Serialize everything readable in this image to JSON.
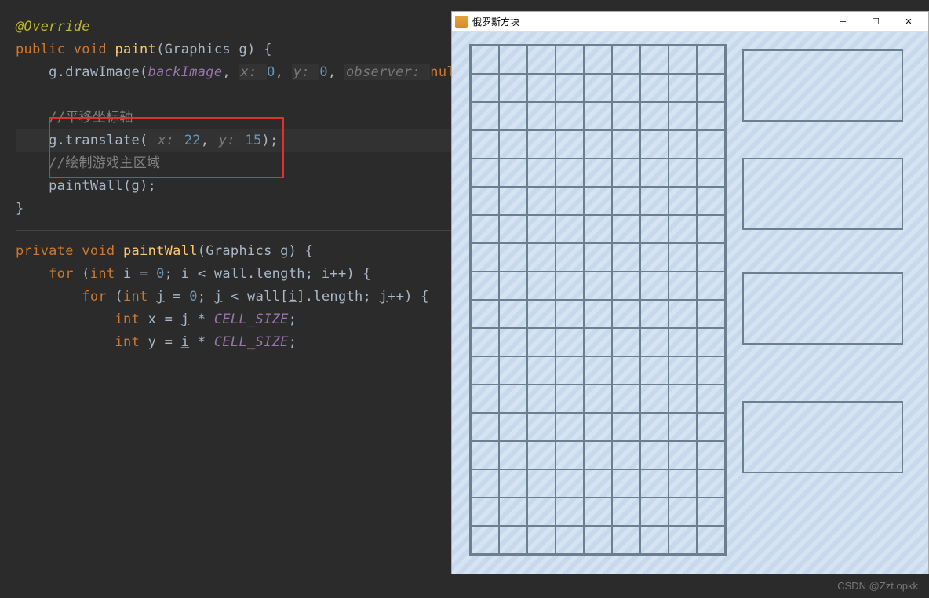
{
  "editor": {
    "lines": [
      {
        "indent": 0,
        "segs": [
          {
            "t": "@Override",
            "c": "annotation"
          }
        ]
      },
      {
        "indent": 0,
        "segs": [
          {
            "t": "public ",
            "c": "kw"
          },
          {
            "t": "void ",
            "c": "kw"
          },
          {
            "t": "paint",
            "c": "method"
          },
          {
            "t": "(Graphics g) {",
            "c": "paren"
          }
        ]
      },
      {
        "indent": 1,
        "segs": [
          {
            "t": "g.drawImage(",
            "c": "paren"
          },
          {
            "t": "backImage",
            "c": "italic"
          },
          {
            "t": ", ",
            "c": "paren"
          },
          {
            "t": "x: ",
            "c": "paramlabel"
          },
          {
            "t": "0",
            "c": "num"
          },
          {
            "t": ", ",
            "c": "paren"
          },
          {
            "t": "y: ",
            "c": "paramlabel"
          },
          {
            "t": "0",
            "c": "num"
          },
          {
            "t": ", ",
            "c": "paren"
          },
          {
            "t": "observer: ",
            "c": "paramlabel"
          },
          {
            "t": "null",
            "c": "kw"
          },
          {
            "t": ");",
            "c": "paren"
          }
        ]
      },
      {
        "indent": 1,
        "segs": [
          {
            "t": "",
            "c": ""
          }
        ]
      },
      {
        "indent": 1,
        "segs": [
          {
            "t": "//平移坐标轴",
            "c": "comment"
          }
        ]
      },
      {
        "indent": 1,
        "hl": true,
        "segs": [
          {
            "t": "g.translate(",
            "c": "paren"
          },
          {
            "t": " x: ",
            "c": "paramlabel"
          },
          {
            "t": "22",
            "c": "num"
          },
          {
            "t": ", ",
            "c": "paren"
          },
          {
            "t": "y: ",
            "c": "paramlabel"
          },
          {
            "t": "15",
            "c": "num"
          },
          {
            "t": ");",
            "c": "paren"
          }
        ]
      },
      {
        "indent": 1,
        "segs": [
          {
            "t": "//绘制游戏主区域",
            "c": "comment"
          }
        ]
      },
      {
        "indent": 1,
        "segs": [
          {
            "t": "paintWall(g);",
            "c": "paren"
          }
        ]
      },
      {
        "indent": 0,
        "segs": [
          {
            "t": "}",
            "c": "paren"
          }
        ]
      }
    ],
    "lines2": [
      {
        "indent": 0,
        "segs": [
          {
            "t": "private ",
            "c": "kw"
          },
          {
            "t": "void ",
            "c": "kw"
          },
          {
            "t": "paintWall",
            "c": "method"
          },
          {
            "t": "(Graphics g) {",
            "c": "paren"
          }
        ]
      },
      {
        "indent": 1,
        "segs": [
          {
            "t": "for ",
            "c": "kw"
          },
          {
            "t": "(",
            "c": "paren"
          },
          {
            "t": "int ",
            "c": "kw"
          },
          {
            "t": "i",
            "c": "under"
          },
          {
            "t": " = ",
            "c": "paren"
          },
          {
            "t": "0",
            "c": "num"
          },
          {
            "t": "; ",
            "c": "paren"
          },
          {
            "t": "i",
            "c": "under"
          },
          {
            "t": " < wall.length; ",
            "c": "paren"
          },
          {
            "t": "i",
            "c": "under"
          },
          {
            "t": "++) {",
            "c": "paren"
          }
        ]
      },
      {
        "indent": 2,
        "segs": [
          {
            "t": "for ",
            "c": "kw"
          },
          {
            "t": "(",
            "c": "paren"
          },
          {
            "t": "int ",
            "c": "kw"
          },
          {
            "t": "j",
            "c": "under"
          },
          {
            "t": " = ",
            "c": "paren"
          },
          {
            "t": "0",
            "c": "num"
          },
          {
            "t": "; ",
            "c": "paren"
          },
          {
            "t": "j",
            "c": "under"
          },
          {
            "t": " < wall[",
            "c": "paren"
          },
          {
            "t": "i",
            "c": "under"
          },
          {
            "t": "].length; ",
            "c": "paren"
          },
          {
            "t": "j",
            "c": "under"
          },
          {
            "t": "++) {",
            "c": "paren"
          }
        ]
      },
      {
        "indent": 3,
        "segs": [
          {
            "t": "int ",
            "c": "kw"
          },
          {
            "t": "x = ",
            "c": "paren"
          },
          {
            "t": "j",
            "c": "under"
          },
          {
            "t": " * ",
            "c": "paren"
          },
          {
            "t": "CELL_SIZE",
            "c": "italic"
          },
          {
            "t": ";",
            "c": "paren"
          }
        ]
      },
      {
        "indent": 3,
        "segs": [
          {
            "t": "int ",
            "c": "kw"
          },
          {
            "t": "y = ",
            "c": "paren"
          },
          {
            "t": "i",
            "c": "under"
          },
          {
            "t": " * ",
            "c": "paren"
          },
          {
            "t": "CELL_SIZE",
            "c": "italic"
          },
          {
            "t": ";",
            "c": "paren"
          }
        ]
      }
    ]
  },
  "app": {
    "title": "俄罗斯方块",
    "grid_cols": 9,
    "grid_rows": 18
  },
  "watermark": "CSDN @Zzt.opkk"
}
